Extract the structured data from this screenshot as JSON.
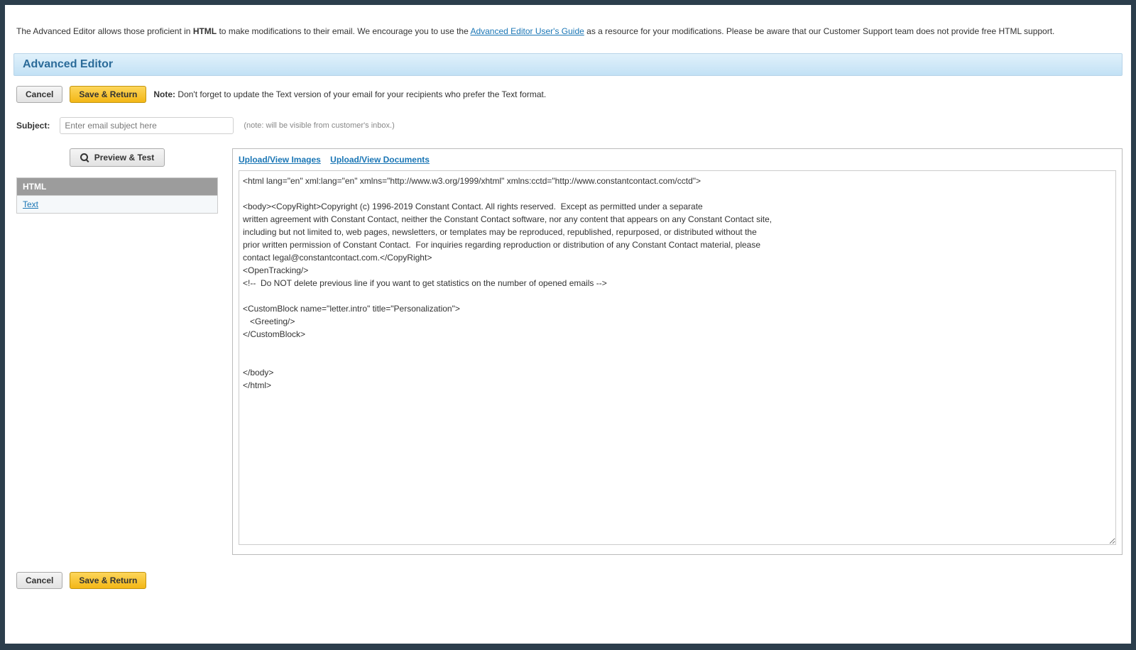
{
  "intro": {
    "part1": "The Advanced Editor allows those proficient in ",
    "html_word": "HTML",
    "part2": " to make modifications to their email. We encourage you to use the ",
    "link_text": "Advanced Editor User's Guide",
    "part3": " as a resource for your modifications. Please be aware that our Customer Support team does not provide free HTML support."
  },
  "header": {
    "title": "Advanced Editor"
  },
  "buttons": {
    "cancel": "Cancel",
    "save_return": "Save & Return",
    "preview_test": "Preview & Test"
  },
  "note": {
    "label": "Note:",
    "text": " Don't forget to update the Text version of your email for your recipients who prefer the Text format."
  },
  "subject": {
    "label": "Subject:",
    "placeholder": "Enter email subject here",
    "value": "",
    "hint": "(note: will be visible from customer's inbox.)"
  },
  "tabs": {
    "html": "HTML",
    "text": "Text"
  },
  "upload": {
    "images": "Upload/View Images",
    "documents": "Upload/View Documents"
  },
  "code": "<html lang=\"en\" xml:lang=\"en\" xmlns=\"http://www.w3.org/1999/xhtml\" xmlns:cctd=\"http://www.constantcontact.com/cctd\">\n\n<body><CopyRight>Copyright (c) 1996-2019 Constant Contact. All rights reserved.  Except as permitted under a separate\nwritten agreement with Constant Contact, neither the Constant Contact software, nor any content that appears on any Constant Contact site,\nincluding but not limited to, web pages, newsletters, or templates may be reproduced, republished, repurposed, or distributed without the\nprior written permission of Constant Contact.  For inquiries regarding reproduction or distribution of any Constant Contact material, please\ncontact legal@constantcontact.com.</CopyRight>\n<OpenTracking/>\n<!--  Do NOT delete previous line if you want to get statistics on the number of opened emails -->\n\n<CustomBlock name=\"letter.intro\" title=\"Personalization\">\n   <Greeting/>\n</CustomBlock>\n\n\n</body>\n</html>"
}
